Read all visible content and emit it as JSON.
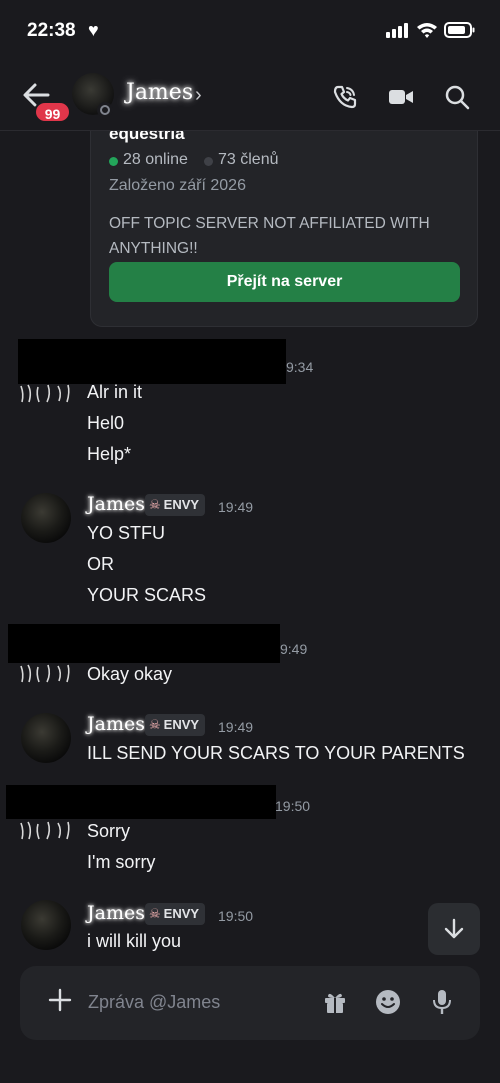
{
  "status_bar": {
    "time": "22:38",
    "heart": "♥"
  },
  "header": {
    "back_badge": "99",
    "name": "James",
    "chevron": "›"
  },
  "server_card": {
    "name": "equestria",
    "online": "28 online",
    "members": "73 členů",
    "founded": "Založeno září 2026",
    "description": "OFF TOPIC SERVER NOT AFFILIATED WITH ANYTHING!!",
    "join_label": "Přejít na server"
  },
  "messages": [
    {
      "author": "",
      "time": "9:34",
      "lines": [
        "Alr in it",
        "Hel0",
        "Help*"
      ]
    },
    {
      "author": "James",
      "tag": "ENVY",
      "time": "19:49",
      "lines": [
        "YO STFU",
        "OR",
        "YOUR SCARS"
      ]
    },
    {
      "author": "",
      "time": "9:49",
      "lines": [
        "Okay okay"
      ]
    },
    {
      "author": "James",
      "tag": "ENVY",
      "time": "19:49",
      "lines": [
        "ILL SEND YOUR SCARS TO YOUR PARENTS"
      ]
    },
    {
      "author": "",
      "time": "19:50",
      "lines": [
        "Sorry",
        "I'm sorry"
      ]
    },
    {
      "author": "James",
      "tag": "ENVY",
      "time": "19:50",
      "lines": [
        "i will kill you"
      ]
    }
  ],
  "composer": {
    "placeholder": "Zpráva @James"
  },
  "colors": {
    "accent_green": "#248046",
    "online_green": "#23a55a",
    "badge_red": "#e0364a",
    "background": "#1a1a1e"
  },
  "icons": [
    "back-arrow-icon",
    "phone-icon",
    "video-icon",
    "search-icon",
    "plus-icon",
    "gift-icon",
    "emoji-icon",
    "mic-icon",
    "arrow-down-icon",
    "skull-icon"
  ]
}
